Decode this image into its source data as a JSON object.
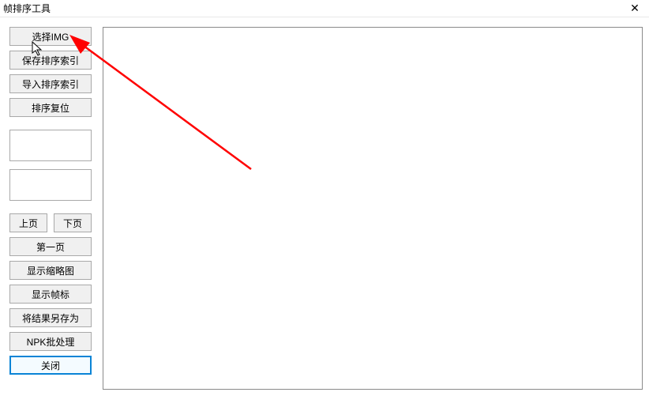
{
  "window": {
    "title": "帧排序工具",
    "close_glyph": "✕"
  },
  "sidebar": {
    "select_img": "选择IMG",
    "save_index": "保存排序索引",
    "import_index": "导入排序索引",
    "reset_sort": "排序复位",
    "prev_page": "上页",
    "next_page": "下页",
    "first_page": "第一页",
    "show_thumbs": "显示缩略图",
    "show_marker": "显示帧标",
    "save_result_as": "将结果另存为",
    "npk_batch": "NPK批处理",
    "close": "关闭"
  }
}
